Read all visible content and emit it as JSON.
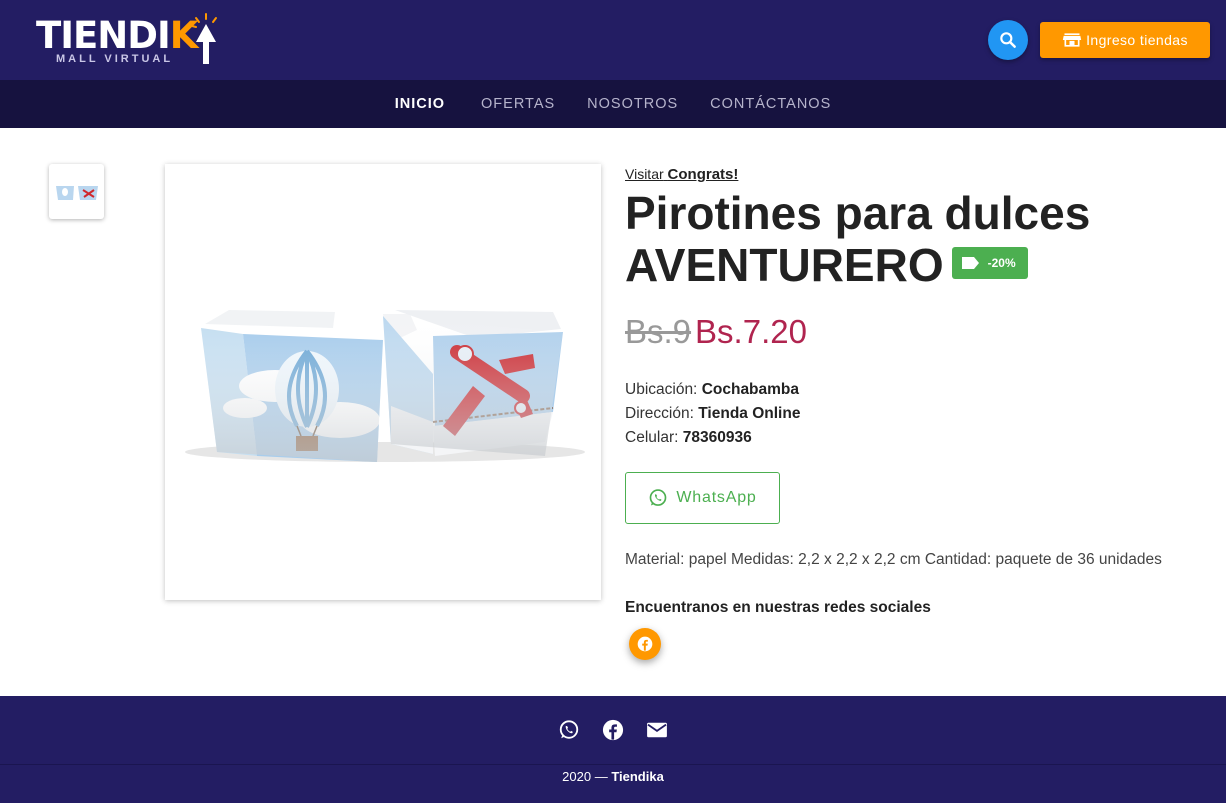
{
  "header": {
    "logo_text_main": "TIENDI",
    "logo_text_k": "K",
    "logo_subtitle": "MALL VIRTUAL",
    "store_button_label": "Ingreso tiendas"
  },
  "nav": {
    "items": [
      {
        "label": "INICIO"
      },
      {
        "label": "OFERTAS"
      },
      {
        "label": "NOSOTROS"
      },
      {
        "label": "CONTÁCTANOS"
      }
    ]
  },
  "product": {
    "visit_prefix": "Visitar",
    "store_name": "Congrats!",
    "title_line1": "Pirotines para dulces",
    "title_line2": "AVENTURERO",
    "discount_badge": "-20%",
    "old_price": "Bs.9",
    "new_price": "Bs.7.20",
    "location_label": "Ubicación:",
    "location_value": "Cochabamba",
    "address_label": "Dirección:",
    "address_value": "Tienda Online",
    "phone_label": "Celular:",
    "phone_value": "78360936",
    "whatsapp_label": "WhatsApp",
    "description": "Material: papel Medidas: 2,2 x 2,2 x 2,2 cm Cantidad: paquete de 36 unidades",
    "social_title": "Encuentranos en nuestras redes sociales"
  },
  "colors": {
    "header_bg": "#231d63",
    "nav_bg": "#16123f",
    "accent_orange": "#ff9800",
    "search_blue": "#2196f3",
    "whatsapp_green": "#4caf50",
    "price_red": "#b0244f"
  },
  "footer": {
    "year": "2020 — ",
    "brand": "Tiendika",
    "icons": [
      "whatsapp-icon",
      "facebook-icon",
      "email-icon"
    ]
  }
}
